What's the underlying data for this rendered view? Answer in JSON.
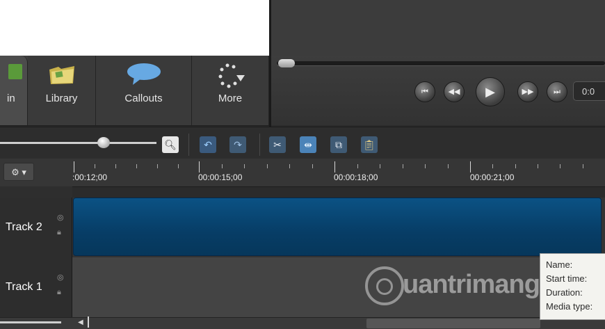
{
  "tabs": {
    "clipbin_label": "in",
    "library_label": "Library",
    "callouts_label": "Callouts",
    "more_label": "More"
  },
  "player": {
    "time_display": "0:0",
    "icons": [
      "skip-back-icon",
      "rewind-icon",
      "play-icon",
      "fast-forward-icon",
      "skip-forward-icon"
    ]
  },
  "toolbar": {
    "icons": [
      "zoom-icon",
      "undo-icon",
      "redo-icon",
      "cut-icon",
      "split-icon",
      "copy-icon",
      "paste-icon"
    ],
    "zoom_level_fraction": 0.62
  },
  "ruler": {
    "labels": [
      ":00:12;00",
      "00:00:15;00",
      "00:00:18;00",
      "00:00:21;00"
    ]
  },
  "tracks": [
    {
      "name": "Track 2"
    },
    {
      "name": "Track 1"
    }
  ],
  "tooltip": {
    "lines": [
      "Name:",
      "Start time:",
      "Duration:",
      "Media type:"
    ]
  },
  "watermark": {
    "text": "uantrimang"
  },
  "colors": {
    "clip_blue": "#0b5284",
    "panel_dark": "#2b2b2b",
    "accent_blue": "#4b83b8"
  }
}
